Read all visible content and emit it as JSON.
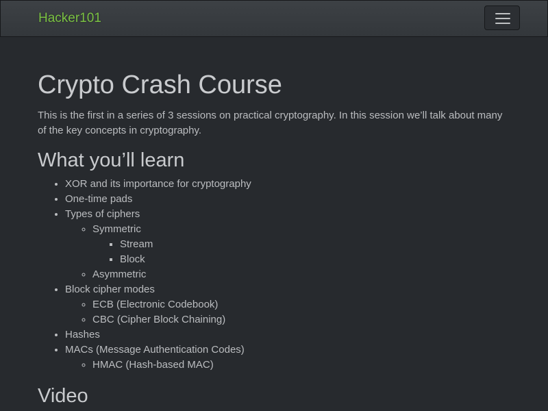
{
  "navbar": {
    "brand": "Hacker101",
    "brand_color": "#7ac142",
    "menu_icon": "hamburger-menu-icon"
  },
  "main": {
    "title": "Crypto Crash Course",
    "intro": "This is the first in a series of 3 sessions on practical cryptography. In this session we’ll talk about many of the key concepts in cryptography.",
    "learn_heading": "What you’ll learn",
    "learn": {
      "xor": "XOR and its importance for cryptography",
      "otp": "One-time pads",
      "types": "Types of ciphers",
      "symmetric": "Symmetric",
      "stream": "Stream",
      "block": "Block",
      "asymmetric": "Asymmetric",
      "modes": "Block cipher modes",
      "ecb": "ECB (Electronic Codebook)",
      "cbc": "CBC (Cipher Block Chaining)",
      "hashes": "Hashes",
      "macs": "MACs (Message Authentication Codes)",
      "hmac": "HMAC (Hash-based MAC)"
    },
    "video_heading": "Video"
  }
}
